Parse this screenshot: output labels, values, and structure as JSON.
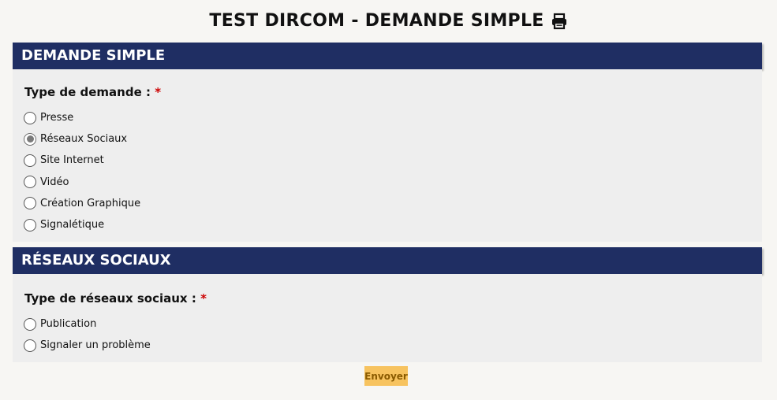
{
  "page": {
    "title": "TEST DIRCOM - DEMANDE SIMPLE"
  },
  "sections": [
    {
      "header": "DEMANDE SIMPLE",
      "question": "Type de demande :",
      "required": "*",
      "options": [
        {
          "label": "Presse",
          "checked": false
        },
        {
          "label": "Réseaux Sociaux",
          "checked": true
        },
        {
          "label": "Site Internet",
          "checked": false
        },
        {
          "label": "Vidéo",
          "checked": false
        },
        {
          "label": "Création Graphique",
          "checked": false
        },
        {
          "label": "Signalétique",
          "checked": false
        }
      ]
    },
    {
      "header": "RÉSEAUX SOCIAUX",
      "question": "Type de réseaux sociaux :",
      "required": "*",
      "options": [
        {
          "label": "Publication",
          "checked": false
        },
        {
          "label": "Signaler un problème",
          "checked": false
        }
      ]
    }
  ],
  "submit": {
    "label": "Envoyer"
  },
  "colors": {
    "header_bg": "#1f2e63",
    "body_bg": "#eeeeee",
    "page_bg": "#f7f6f3",
    "required": "#cc0000",
    "submit_bg": "#f7c35f"
  },
  "icons": {
    "print": "print-icon"
  }
}
